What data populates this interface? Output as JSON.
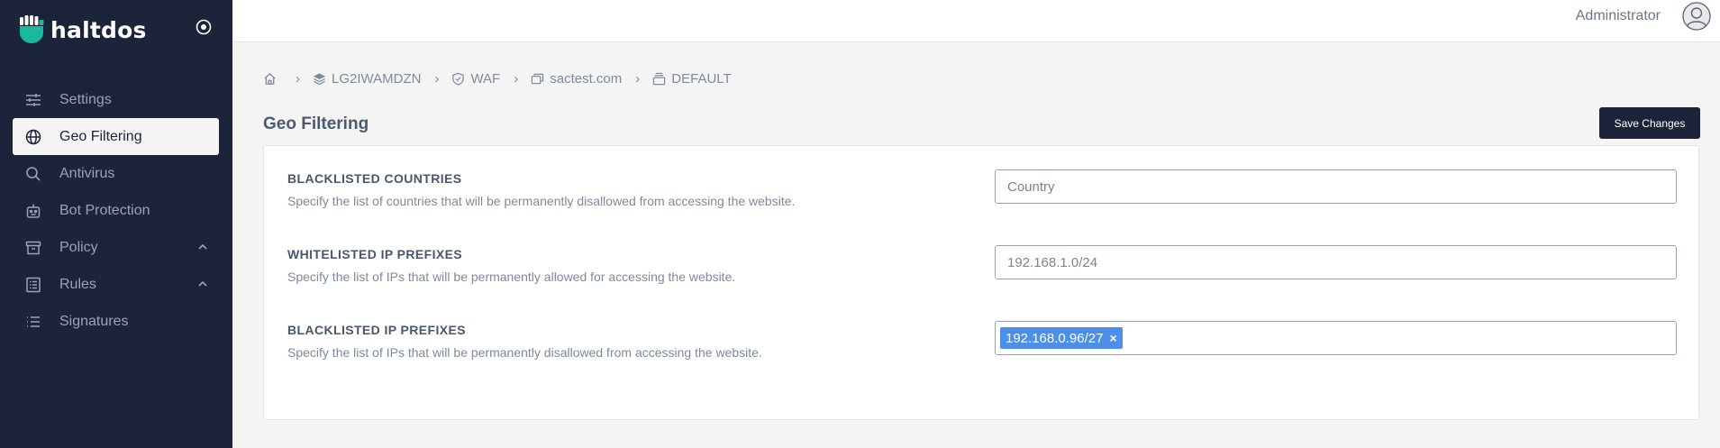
{
  "app": {
    "brand": "haltdos",
    "colors": {
      "sidebar": "#1b2439",
      "logo": "#1ab99d",
      "tag": "#4d8ee6",
      "button": "#1b2439"
    }
  },
  "sidebar": {
    "items": [
      {
        "label": "Settings",
        "icon": "sliders-icon",
        "active": false
      },
      {
        "label": "Geo Filtering",
        "icon": "globe-icon",
        "active": true
      },
      {
        "label": "Antivirus",
        "icon": "search-icon",
        "active": false
      },
      {
        "label": "Bot Protection",
        "icon": "robot-icon",
        "active": false
      },
      {
        "label": "Policy",
        "icon": "archive-icon",
        "active": false,
        "expandable": true
      },
      {
        "label": "Rules",
        "icon": "list-icon",
        "active": false,
        "expandable": true
      },
      {
        "label": "Signatures",
        "icon": "bullet-list-icon",
        "active": false
      }
    ]
  },
  "header": {
    "user": "Administrator"
  },
  "breadcrumb": [
    {
      "label": "",
      "icon": "home-icon"
    },
    {
      "label": "LG2IWAMDZN",
      "icon": "layers-icon"
    },
    {
      "label": "WAF",
      "icon": "shield-icon"
    },
    {
      "label": "sactest.com",
      "icon": "windows-icon"
    },
    {
      "label": "DEFAULT",
      "icon": "stack-icon"
    }
  ],
  "page": {
    "title": "Geo Filtering",
    "save_label": "Save Changes"
  },
  "fields": {
    "blacklisted_countries": {
      "title": "BLACKLISTED COUNTRIES",
      "description": "Specify the list of countries that will be permanently disallowed from accessing the website.",
      "placeholder": "Country",
      "value": ""
    },
    "whitelisted_ip": {
      "title": "WHITELISTED IP PREFIXES",
      "description": "Specify the list of IPs that will be permanently allowed for accessing the website.",
      "placeholder": "192.168.1.0/24",
      "value": ""
    },
    "blacklisted_ip": {
      "title": "BLACKLISTED IP PREFIXES",
      "description": "Specify the list of IPs that will be permanently disallowed from accessing the website.",
      "tags": [
        "192.168.0.96/27"
      ],
      "tag_remove": "×"
    }
  }
}
